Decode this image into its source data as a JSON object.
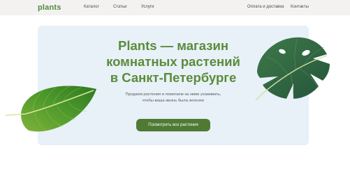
{
  "header": {
    "logo": "plants",
    "nav": {
      "catalog": "Каталог",
      "articles": "Статьи",
      "services": "Услуги",
      "payment": "Оплата и доставка",
      "contacts": "Контакты"
    }
  },
  "hero": {
    "title_lines": [
      "Plants — магазин",
      "комнатных растений",
      "в Санкт-Петербурге"
    ],
    "subtitle_lines": [
      "Продаем растения и помогаем за ними ухаживать,",
      "чтобы ваша жизнь была зеленее"
    ],
    "cta_label": "Посмотреть все растения"
  },
  "colors": {
    "brand_green": "#4f8a3c",
    "title_green": "#5a8c3a",
    "button_green": "#4f7a33",
    "hero_bg": "#e8f0f8",
    "header_bg": "#f3f2f1"
  },
  "icons": {
    "left_leaf": "ficus-leaf-icon",
    "right_leaf": "monstera-leaf-icon"
  }
}
